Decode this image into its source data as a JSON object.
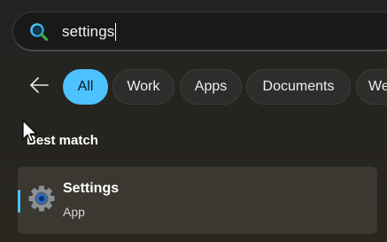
{
  "search": {
    "value": "settings",
    "icon": "search-icon"
  },
  "filters": {
    "back_icon": "back-arrow-icon",
    "chips": [
      {
        "label": "All",
        "active": true
      },
      {
        "label": "Work",
        "active": false
      },
      {
        "label": "Apps",
        "active": false
      },
      {
        "label": "Documents",
        "active": false
      },
      {
        "label": "We",
        "active": false
      }
    ]
  },
  "section": {
    "heading": "Best match"
  },
  "result": {
    "title": "Settings",
    "subtitle": "App",
    "icon": "gear-icon"
  },
  "colors": {
    "accent": "#4cc2ff",
    "card": "#3a3831",
    "background": "#232323"
  }
}
